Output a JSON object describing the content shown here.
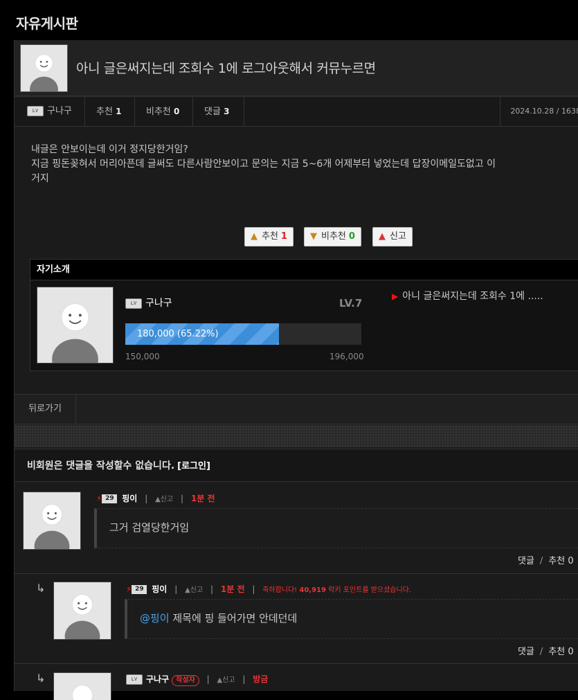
{
  "board": {
    "title": "자유게시판"
  },
  "post": {
    "title": "아니 글은써지는데 조회수 1에 로그아웃해서 커뮤누르면",
    "author": "구나구",
    "recommend_label": "추천",
    "recommend_count": "1",
    "unrecommend_label": "비추천",
    "unrecommend_count": "0",
    "comment_label": "댓글",
    "comment_count": "3",
    "date": "2024.10.28 / 1638",
    "body": "내글은 안보이는데 이거 정지당한거임?\n지금 핑돈꽂혀서 머리아픈데 글써도 다른사람안보이고 문의는 지금 5~6개 어제부터 넣었는데 답장이메일도없고 이\n거지"
  },
  "votes": {
    "recommend_label": "추천",
    "recommend_count": "1",
    "unrecommend_label": "비추천",
    "unrecommend_count": "0",
    "report_label": "신고"
  },
  "intro": {
    "header": "자기소개",
    "nickname": "구나구",
    "level": "LV.7",
    "progress_text": "180,000 (65.22%)",
    "progress_fraction": 0.6522,
    "min_exp": "150,000",
    "max_exp": "196,000",
    "recent_post": "아니 글은써지는데 조회수 1에 ....."
  },
  "nav": {
    "back_label": "뒤로가기"
  },
  "comments_notice": {
    "text": "비회원은 댓글을 작성할수 없습니다.",
    "login": "[로그인]"
  },
  "comments": [
    {
      "level": "29",
      "nick": "핑이",
      "report": "신고",
      "time": "1분 전",
      "text": "그거 검열당한거임",
      "foot_reply": "댓글",
      "foot_recommend": "추천 0"
    },
    {
      "level": "29",
      "nick": "핑이",
      "report": "신고",
      "time": "1분 전",
      "luck_prefix": "축하합니다! ",
      "luck_points": "40,919",
      "luck_suffix": " 럭키 포인트를 받으셨습니다.",
      "mention": "@핑이",
      "text": " 제목에 핑 들어가면 안데던데",
      "foot_reply": "댓글",
      "foot_recommend": "추천 0"
    },
    {
      "nick": "구나구",
      "author_tag": "작성자",
      "report": "신고",
      "time": "방금"
    }
  ],
  "colors": {
    "accent": "#e33333",
    "progress": "#3d8ed8",
    "mention": "#4aa3e8"
  }
}
